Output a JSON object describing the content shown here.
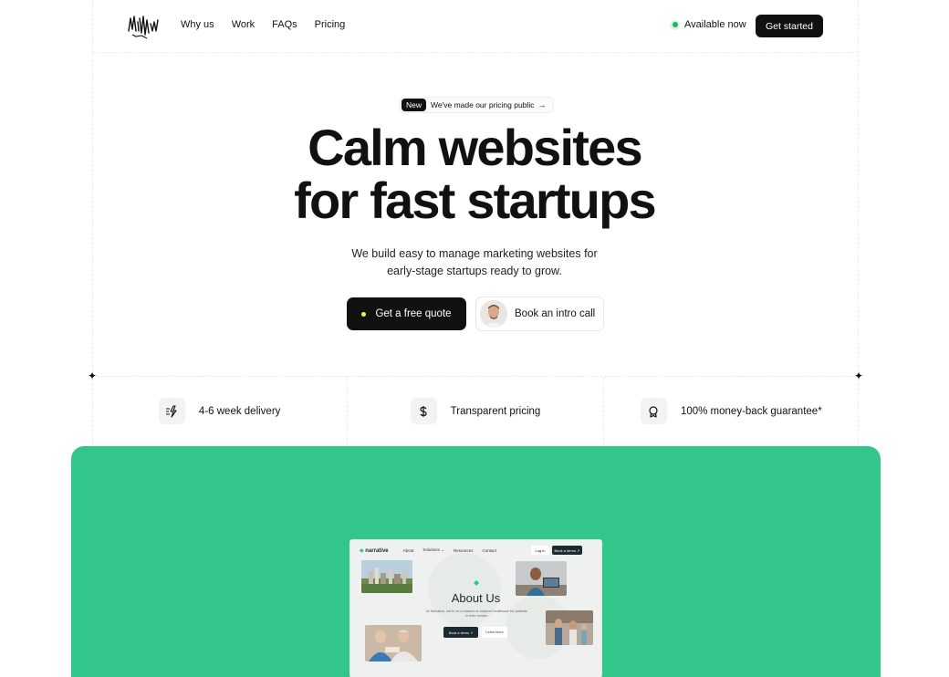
{
  "nav": {
    "logo_alt": "msw logo",
    "links": [
      "Why us",
      "Work",
      "FAQs",
      "Pricing"
    ],
    "status": "Available now",
    "cta": "Get started"
  },
  "hero": {
    "pill_tag": "New",
    "pill_text": "We've made our pricing public",
    "pill_arrow": "→",
    "headline_1": "Calm websites",
    "headline_2": "for fast startups",
    "sub_1": "We build easy to manage marketing websites for",
    "sub_2": "early-stage startups ready to grow.",
    "primary_cta": "Get a free quote",
    "secondary_cta": "Book an intro call"
  },
  "features": [
    {
      "icon": "lightning-icon",
      "label": "4-6 week delivery"
    },
    {
      "icon": "dollar-icon",
      "label": "Transparent pricing"
    },
    {
      "icon": "badge-icon",
      "label": "100% money-back guarantee*"
    }
  ],
  "showcase": {
    "brand": "narrative",
    "links": [
      "About",
      "Solutions ⌄",
      "Resources",
      "Contact"
    ],
    "login": "Log in",
    "demo": "Book a demo ↗",
    "title": "About Us",
    "subtitle": "At Narrative, we're on a mission to improve healthcare for patients in their homes.",
    "btn_primary": "Book a demo ↗",
    "btn_secondary": "Learn more"
  },
  "colors": {
    "accent_green": "#33c68b",
    "dark": "#111111",
    "status_green": "#22b566"
  }
}
